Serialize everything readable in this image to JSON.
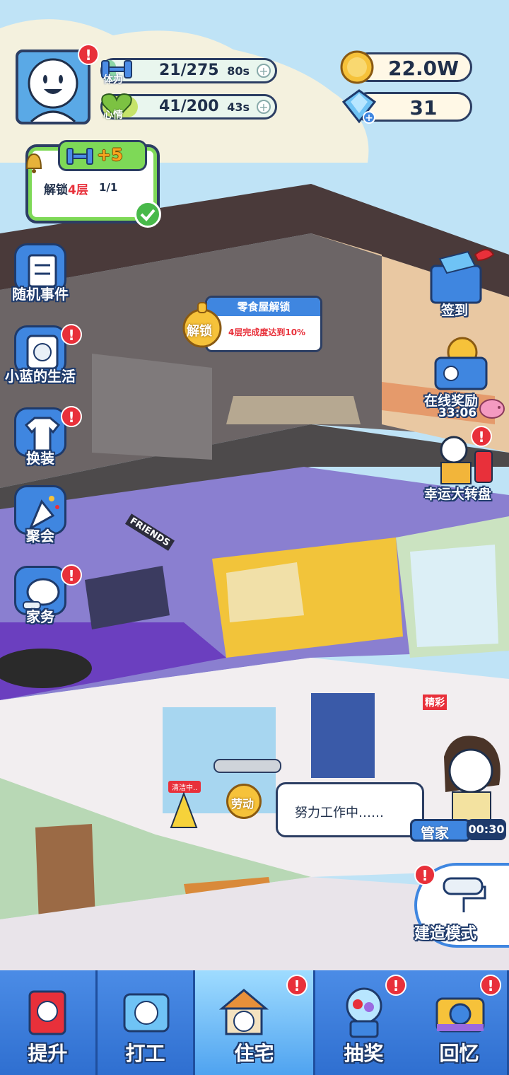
{
  "hud": {
    "stamina_label": "体力",
    "stamina_value": "21/275",
    "stamina_timer": "80s",
    "stamina_fraction": 0.076,
    "mood_label": "心情",
    "mood_value": "41/200",
    "mood_timer": "43s",
    "mood_fraction": 0.205,
    "coins": "22.0W",
    "gems": "31",
    "plus_glyph": "+"
  },
  "quest": {
    "reward": "+5",
    "text_prefix": "解锁",
    "text_highlight": "4层",
    "progress": "1/1"
  },
  "left_menu": [
    {
      "label": "随机事件",
      "icon": "notepad-icon",
      "badge": false
    },
    {
      "label": "小蓝的生活",
      "icon": "diary-icon",
      "badge": true
    },
    {
      "label": "换装",
      "icon": "tshirt-icon",
      "badge": true
    },
    {
      "label": "聚会",
      "icon": "party-popper-icon",
      "badge": false
    },
    {
      "label": "家务",
      "icon": "vacuum-icon",
      "badge": true
    }
  ],
  "right_menu": {
    "checkin_label": "签到",
    "online_label": "在线奖励",
    "online_timer": "33:06",
    "wheel_label": "幸运大转盘"
  },
  "unlock_popup": {
    "title": "零食屋解锁",
    "button": "解锁",
    "condition": "4层完成度达到10%"
  },
  "room_labels": {
    "cleaning": "清洁中..",
    "labor_button": "劳动",
    "friends_banner": "FRIENDS",
    "poster_text": "精彩"
  },
  "butler": {
    "speech": "努力工作中……",
    "label": "管家",
    "timer": "00:30"
  },
  "build_mode": {
    "label": "建造模式"
  },
  "bottom_nav": [
    {
      "label": "提升",
      "icon": "book-icon",
      "badge": false,
      "active": false
    },
    {
      "label": "打工",
      "icon": "id-badge-icon",
      "badge": false,
      "active": false
    },
    {
      "label": "住宅",
      "icon": "house-icon",
      "badge": true,
      "active": true
    },
    {
      "label": "抽奖",
      "icon": "gacha-machine-icon",
      "badge": true,
      "active": false
    },
    {
      "label": "回忆",
      "icon": "camera-icon",
      "badge": true,
      "active": false
    }
  ]
}
